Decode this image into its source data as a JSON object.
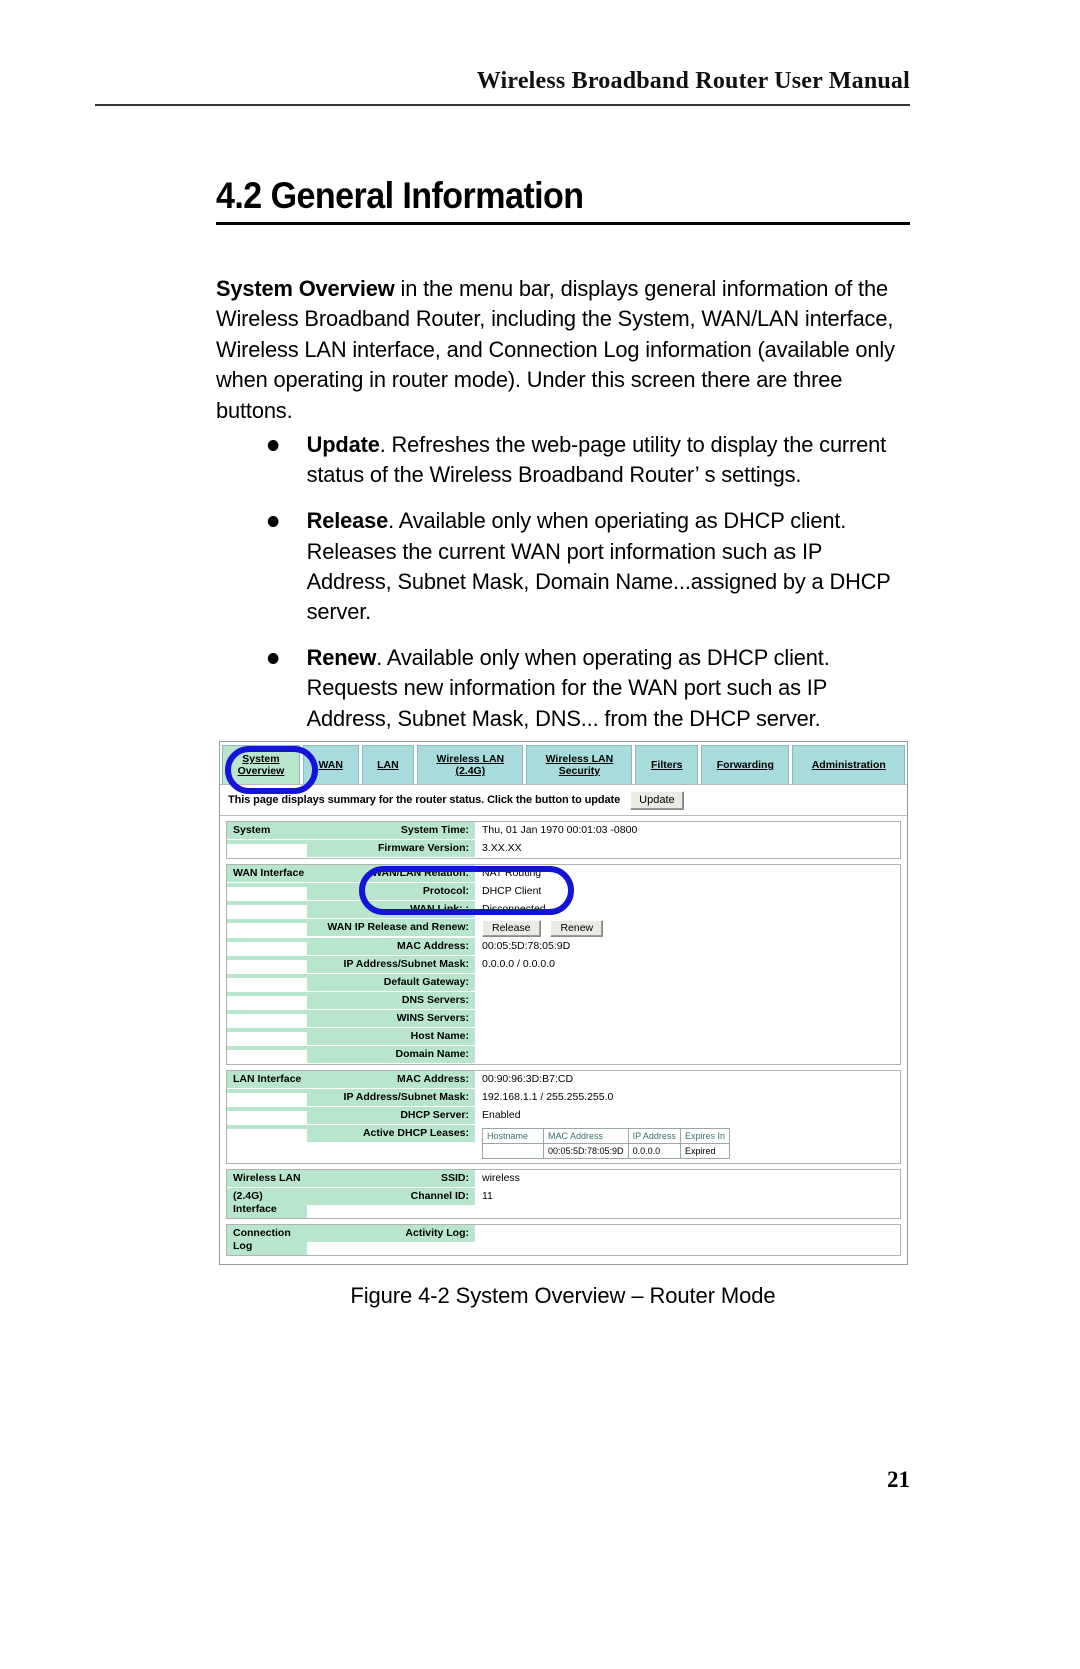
{
  "page": {
    "running_header": "Wireless Broadband Router User Manual",
    "page_number": "21",
    "section_heading": "4.2 General Information",
    "intro_bold": "System Overview",
    "intro_rest": " in the menu bar, displays general information of the Wireless Broadband Router, including the System, WAN/LAN interface, Wireless LAN interface, and Connection Log information (available only when operating in router mode). Under this screen there are three buttons.",
    "figure_caption": "Figure 4-2  System Overview – Router Mode"
  },
  "bullets": [
    {
      "term": "Update",
      "text": ". Refreshes the web-page utility to display the current status of the Wireless Broadband Router’ s settings."
    },
    {
      "term": "Release",
      "text": ". Available only when operiating as DHCP client. Releases the current WAN port information such as IP Address, Subnet Mask, Domain Name...assigned by a DHCP server."
    },
    {
      "term": "Renew",
      "text": ". Available only when operating as DHCP client. Requests new information for the WAN port such as IP Address, Subnet Mask, DNS... from the DHCP server."
    }
  ],
  "screenshot": {
    "tabs": [
      {
        "line1": "System",
        "line2": "Overview",
        "active": true
      },
      {
        "line1": "WAN",
        "line2": "",
        "active": false
      },
      {
        "line1": "LAN",
        "line2": "",
        "active": false
      },
      {
        "line1": "Wireless LAN",
        "line2": "(2.4G)",
        "active": false
      },
      {
        "line1": "Wireless LAN",
        "line2": "Security",
        "active": false
      },
      {
        "line1": "Filters",
        "line2": "",
        "active": false
      },
      {
        "line1": "Forwarding",
        "line2": "",
        "active": false
      },
      {
        "line1": "Administration",
        "line2": "",
        "active": false
      }
    ],
    "instruction": "This page displays summary for the router status. Click the button to update",
    "update_button": "Update",
    "sections": {
      "system": {
        "group": "System",
        "rows": [
          {
            "label": "System Time:",
            "value": "Thu, 01 Jan 1970 00:01:03 -0800"
          },
          {
            "label": "Firmware Version:",
            "value": "3.XX.XX"
          }
        ]
      },
      "wan": {
        "group": "WAN Interface",
        "rows": [
          {
            "label": "WAN/LAN Relation:",
            "value": "NAT Routing"
          },
          {
            "label": "Protocol:",
            "value": "DHCP Client"
          },
          {
            "label": "WAN Link: :",
            "value": "Disconnected"
          },
          {
            "label": "WAN IP Release and Renew:",
            "value": ""
          },
          {
            "label": "MAC Address:",
            "value": "00:05:5D:78:05:9D"
          },
          {
            "label": "IP Address/Subnet Mask:",
            "value": "0.0.0.0 / 0.0.0.0"
          },
          {
            "label": "Default Gateway:",
            "value": ""
          },
          {
            "label": "DNS Servers:",
            "value": ""
          },
          {
            "label": "WINS Servers:",
            "value": ""
          },
          {
            "label": "Host Name:",
            "value": ""
          },
          {
            "label": "Domain Name:",
            "value": ""
          }
        ],
        "release_button": "Release",
        "renew_button": "Renew"
      },
      "lan": {
        "group": "LAN Interface",
        "rows": [
          {
            "label": "MAC Address:",
            "value": "00:90:96:3D:B7:CD"
          },
          {
            "label": "IP Address/Subnet Mask:",
            "value": "192.168.1.1 / 255.255.255.0"
          },
          {
            "label": "DHCP Server:",
            "value": "Enabled"
          },
          {
            "label": "Active DHCP Leases:",
            "value": ""
          }
        ],
        "leases": {
          "columns": [
            "Hostname",
            "MAC Address",
            "IP Address",
            "Expires In"
          ],
          "rows": [
            {
              "hostname": "",
              "mac": "00:05:5D:78:05:9D",
              "ip": "0.0.0.0",
              "expires": "Expired"
            }
          ]
        }
      },
      "wlan": {
        "group_line1": "Wireless LAN",
        "group_line2": "(2.4G) Interface",
        "rows": [
          {
            "label": "SSID:",
            "value": "wireless"
          },
          {
            "label": "Channel ID:",
            "value": "11"
          }
        ]
      },
      "log": {
        "group": "Connection Log",
        "rows": [
          {
            "label": "Activity Log:",
            "value": ""
          }
        ]
      }
    },
    "annotation_color": "#1414d8"
  }
}
